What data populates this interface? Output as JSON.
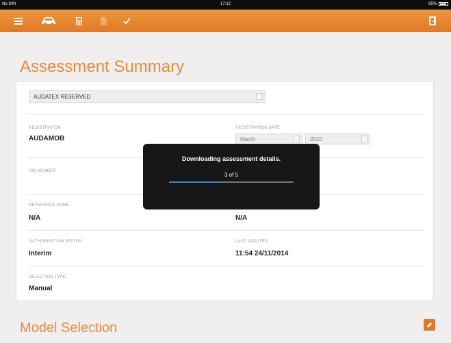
{
  "status_bar": {
    "carrier": "No SIM",
    "time": "17:12",
    "battery": "85%"
  },
  "page": {
    "title": "Assessment Summary"
  },
  "header_select": {
    "value": "AUDATEX RESERVED"
  },
  "fields": {
    "registration": {
      "label": "REGISTRATION",
      "value": "AUDAMOB"
    },
    "registration_date": {
      "label": "REGISTRATION DATE",
      "month": "March",
      "year": "2010"
    },
    "vin": {
      "label": "VIN NUMBER"
    },
    "reference_name": {
      "label": "REFERENCE NAME",
      "value": "N/A"
    },
    "reference_right": {
      "value": "N/A"
    },
    "authorisation": {
      "label": "AUTHORISATION STATUS",
      "value": "Interim"
    },
    "last_updated": {
      "label": "LAST UPDATED",
      "value": "11:54 24/11/2014"
    },
    "selection_type": {
      "label": "SELECTION TYPE",
      "value": "Manual"
    }
  },
  "section": {
    "title": "Model Selection"
  },
  "progress": {
    "message": "Downloading assessment details.",
    "count": "3 of 5",
    "fraction": 0.4
  },
  "icons": [
    "menu-icon",
    "car-icon",
    "calculator-icon",
    "document-icon",
    "checkmark-icon",
    "exit-door-icon",
    "edit-pencil-icon"
  ],
  "colors": {
    "accent": "#e98a3b",
    "toolbar": "#e88a33",
    "progress": "#3a86d6"
  }
}
